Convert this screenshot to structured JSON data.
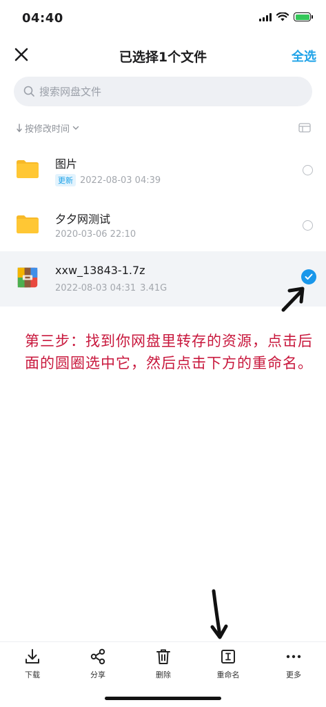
{
  "status_bar": {
    "time": "04:40"
  },
  "nav": {
    "title": "已选择1个文件",
    "select_all": "全选"
  },
  "search": {
    "placeholder": "搜索网盘文件"
  },
  "sort": {
    "label": "按修改时间"
  },
  "files": [
    {
      "name": "图片",
      "badge": "更新",
      "date": "2022-08-03 04:39",
      "size": "",
      "type": "folder",
      "selected": false
    },
    {
      "name": "夕夕网测试",
      "badge": "",
      "date": "2020-03-06 22:10",
      "size": "",
      "type": "folder",
      "selected": false
    },
    {
      "name": "xxw_13843-1.7z",
      "badge": "",
      "date": "2022-08-03 04:31",
      "size": "3.41G",
      "type": "archive",
      "selected": true
    }
  ],
  "annotation": {
    "text": "第三步：找到你网盘里转存的资源，点击后面的圆圈选中它，然后点击下方的重命名。"
  },
  "bottom_bar": {
    "download": "下载",
    "share": "分享",
    "delete": "删除",
    "rename": "重命名",
    "more": "更多"
  },
  "colors": {
    "accent": "#1fa3e8",
    "annotation": "#c8173c",
    "folder": "#ffc734"
  }
}
